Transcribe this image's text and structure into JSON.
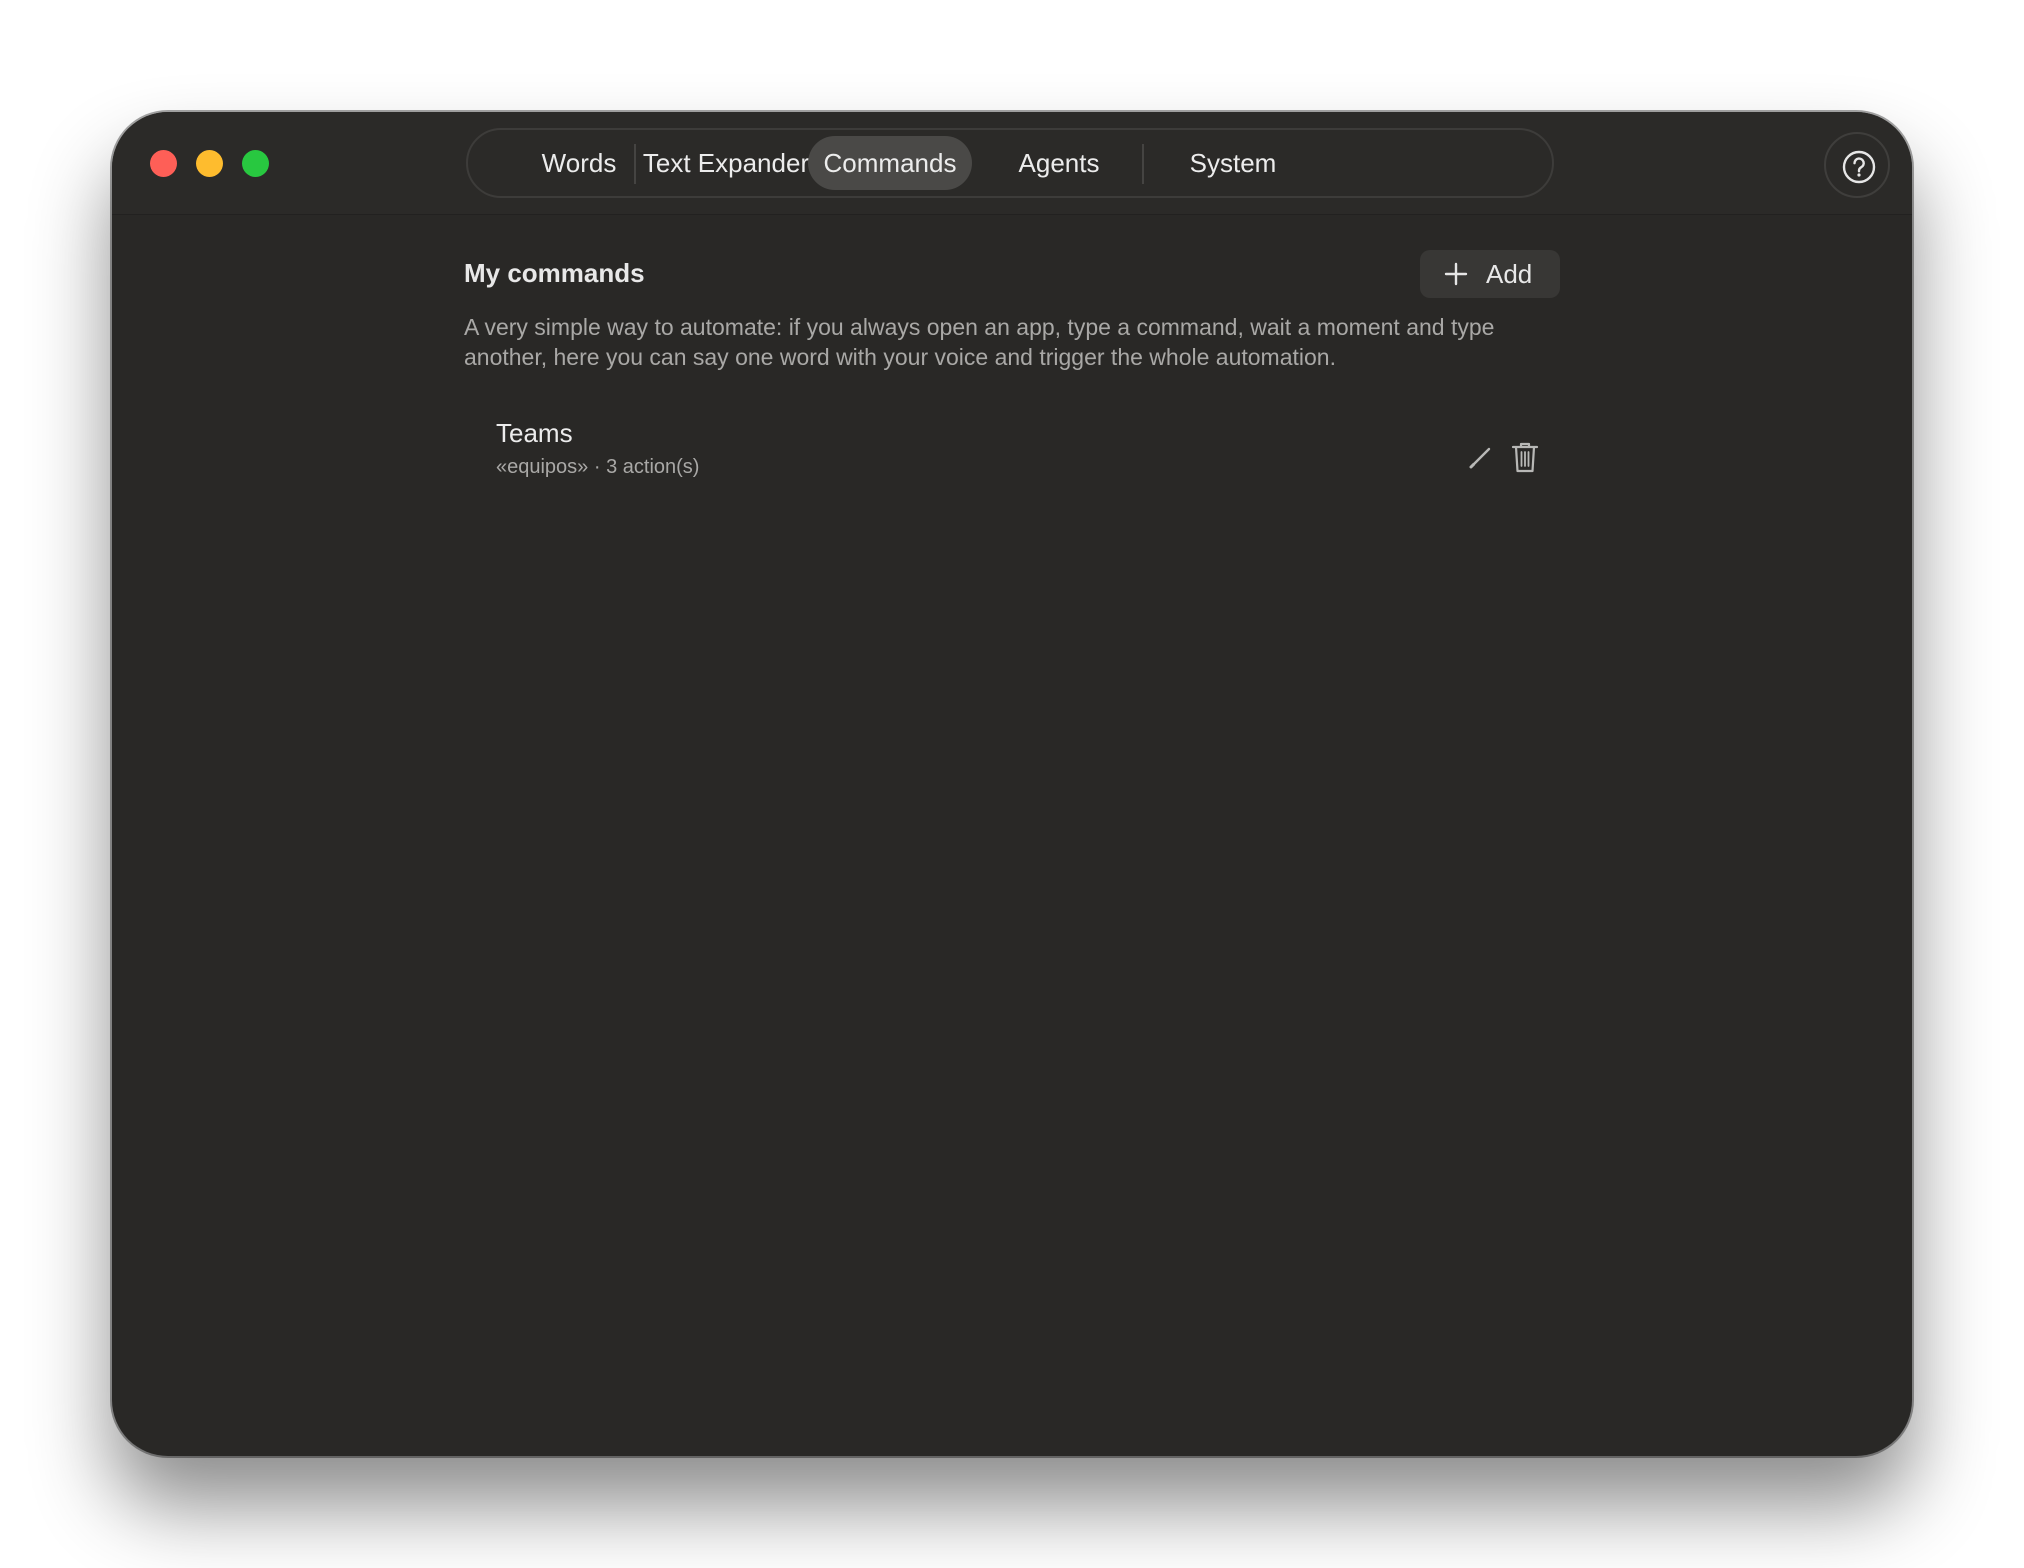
{
  "window": {
    "traffic_lights": [
      "close",
      "minimize",
      "zoom"
    ]
  },
  "tabs": [
    {
      "label": "Words",
      "active": false
    },
    {
      "label": "Text Expander",
      "active": false
    },
    {
      "label": "Commands",
      "active": true
    },
    {
      "label": "Agents",
      "active": false
    },
    {
      "label": "System",
      "active": false
    }
  ],
  "toolbar": {
    "help_icon": "question-mark-circle-icon"
  },
  "main": {
    "title": "My commands",
    "add_label": "Add",
    "add_icon": "plus-icon",
    "description": "A very simple way to automate: if you always open an app, type a command, wait a moment and type another, here you can say one word with your voice and trigger the whole automation.",
    "commands": [
      {
        "name": "Teams",
        "meta": "«equipos» · 3 action(s)",
        "edit_icon": "pencil-icon",
        "delete_icon": "trash-icon"
      }
    ]
  },
  "colors": {
    "window_bg": "#292826",
    "active_tab": "#4a4947",
    "close": "#fe5f57",
    "minimize": "#febc2e",
    "zoom": "#28c840"
  }
}
